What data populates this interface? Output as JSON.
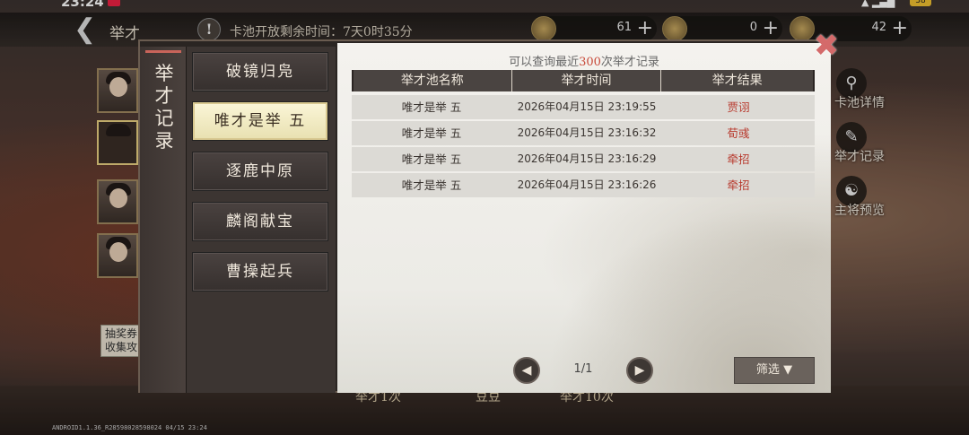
{
  "status_bar": {
    "time": "23:24",
    "battery": "38"
  },
  "top_bar": {
    "title": "举才",
    "timer_label": "卡池开放剩余时间：7天0时35分",
    "currencies": [
      {
        "icon": "coin-icon",
        "value": "61"
      },
      {
        "icon": "jade-icon",
        "value": "0"
      },
      {
        "icon": "token-icon",
        "value": "42"
      }
    ]
  },
  "side": {
    "tip": "抽奖券收集攻"
  },
  "right_actions": [
    {
      "icon": "magnifier-icon",
      "label": "卡池详情"
    },
    {
      "icon": "brush-icon",
      "label": "举才记录"
    },
    {
      "icon": "general-icon",
      "label": "主将预览"
    }
  ],
  "bottom_bar": {
    "left_btn": "举才1次",
    "center_btn": "豆豆",
    "right_btn": "举才10次"
  },
  "version": "ANDROID1.1.36_R28598028598024 04/15 23:24",
  "modal": {
    "title": "举才记录",
    "hint_prefix": "可以查询最近",
    "hint_number": "300",
    "hint_suffix": "次举才记录",
    "tabs": [
      "破镜归凫",
      "唯才是举 五",
      "逐鹿中原",
      "麟阁献宝",
      "曹操起兵"
    ],
    "active_tab": 1,
    "columns": [
      "举才池名称",
      "举才时间",
      "举才结果"
    ],
    "rows": [
      {
        "pool": "唯才是举 五",
        "time": "2026年04月15日 23:19:55",
        "result": "贾诩"
      },
      {
        "pool": "唯才是举 五",
        "time": "2026年04月15日 23:16:32",
        "result": "荀彧"
      },
      {
        "pool": "唯才是举 五",
        "time": "2026年04月15日 23:16:29",
        "result": "牵招"
      },
      {
        "pool": "唯才是举 五",
        "time": "2026年04月15日 23:16:26",
        "result": "牵招"
      }
    ],
    "pagination": "1/1",
    "filter_label": "筛选"
  }
}
